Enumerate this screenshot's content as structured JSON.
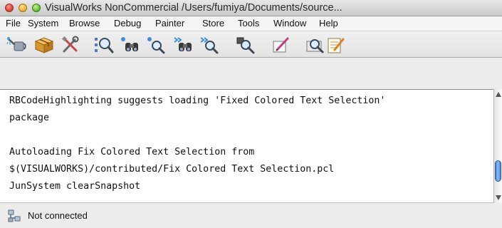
{
  "window": {
    "title": "VisualWorks NonCommercial  /Users/fumiya/Documents/source..."
  },
  "menu": {
    "items": [
      "File",
      "System",
      "Browse",
      "Debug",
      "Painter",
      "Store",
      "Tools",
      "Window",
      "Help"
    ]
  },
  "toolbar": {
    "icons": [
      "watering-can-icon",
      "package-icon",
      "tools-icon",
      "magnifier-tree-icon",
      "binoculars-implementors-icon",
      "senders-search-icon",
      "binoculars-forward-icon",
      "references-search-icon",
      "inspect-magnifier-icon",
      "edit-pencil-icon",
      "search-folder-icon",
      "notepad-icon"
    ]
  },
  "transcript": {
    "lines": [
      "RBCodeHighlighting suggests loading 'Fixed Colored Text Selection'",
      "package",
      "",
      "Autoloading Fix Colored Text Selection from",
      "$(VISUALWORKS)/contributed/Fix Colored Text Selection.pcl",
      "JunSystem clearSnapshot"
    ],
    "selected_line_index": 5
  },
  "status": {
    "text": "Not connected",
    "icon": "network-disconnected-icon"
  },
  "colors": {
    "selection": "#b5d2f2",
    "scroll_thumb": "#4a86d6"
  }
}
